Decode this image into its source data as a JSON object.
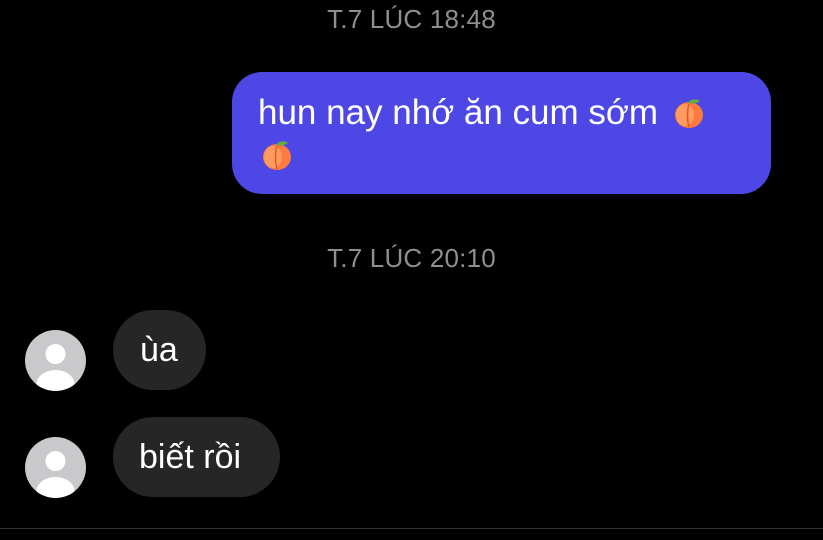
{
  "conversation": {
    "timestamps": [
      "T.7 LÚC 18:48",
      "T.7 LÚC 20:10"
    ],
    "outgoing": {
      "text": "hun nay nhớ ăn cum sớm",
      "emojis": [
        "peach-icon",
        "peach-icon"
      ]
    },
    "incoming": [
      {
        "text": "ùa"
      },
      {
        "text": "biết rồi"
      }
    ]
  },
  "colors": {
    "background": "#000000",
    "outgoing_bubble": "#4d47e5",
    "incoming_bubble": "#262626",
    "timestamp_text": "#8e8e93",
    "avatar_placeholder": "#c9c9cc"
  }
}
